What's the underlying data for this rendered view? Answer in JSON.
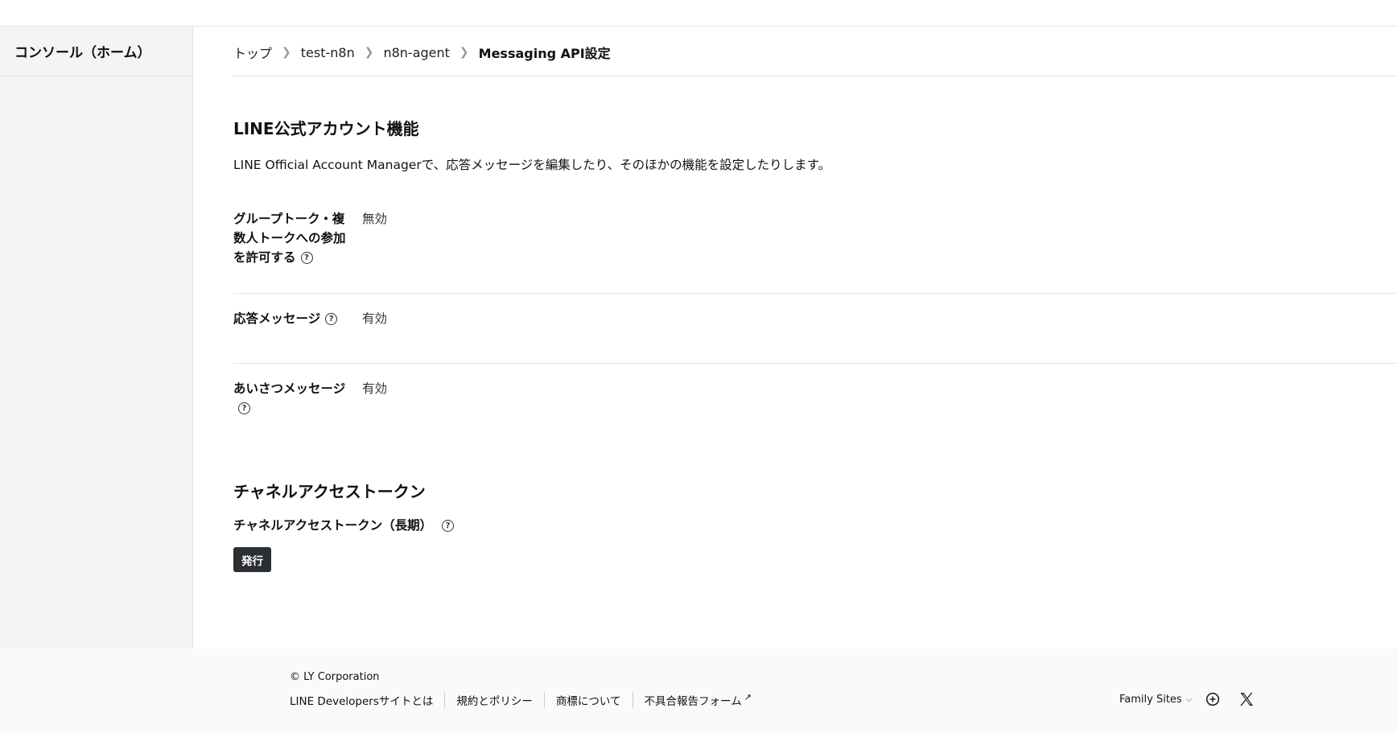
{
  "sidebar": {
    "home_label": "コンソール（ホーム）"
  },
  "breadcrumb": {
    "items": [
      "トップ",
      "test-n8n",
      "n8n-agent"
    ],
    "current": "Messaging API設定"
  },
  "line_features": {
    "title": "LINE公式アカウント機能",
    "description": "LINE Official Account Managerで、応答メッセージを編集したり、そのほかの機能を設定したりします。",
    "rows": [
      {
        "label": "グループトーク・複数人トークへの参加を許可する",
        "value": "無効"
      },
      {
        "label": "応答メッセージ",
        "value": "有効"
      },
      {
        "label": "あいさつメッセージ",
        "value": "有効"
      }
    ]
  },
  "access_token": {
    "title": "チャネルアクセストークン",
    "label": "チャネルアクセストークン（長期）",
    "issue_button": "発行"
  },
  "footer": {
    "copyright": "© LY Corporation",
    "links": [
      "LINE Developersサイトとは",
      "規約とポリシー",
      "商標について",
      "不具合報告フォーム"
    ],
    "family_sites": "Family Sites"
  }
}
